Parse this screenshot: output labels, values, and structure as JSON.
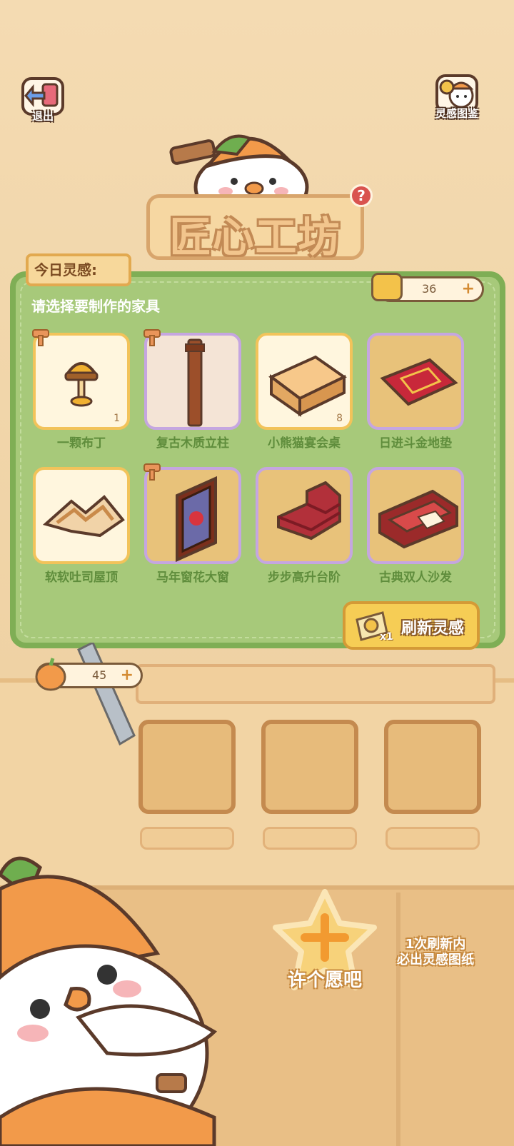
{
  "header": {
    "exit_label": "退出",
    "codex_label": "灵感图鉴",
    "title": "匠心工坊",
    "help_glyph": "?"
  },
  "panel": {
    "today_label": "今日灵感:",
    "prompt": "请选择要制作的家具",
    "inspiration_count": "36",
    "plus_glyph": "+",
    "refresh_label": "刷新灵感",
    "refresh_cost": "x1"
  },
  "items": [
    {
      "name": "一颗布丁",
      "count": "1",
      "icon": "pudding-lamp-icon"
    },
    {
      "name": "复古木质立柱",
      "count": "",
      "icon": "wooden-pillar-icon"
    },
    {
      "name": "小熊猫宴会桌",
      "count": "8",
      "icon": "banquet-table-icon"
    },
    {
      "name": "日进斗金地垫",
      "count": "",
      "icon": "red-rug-icon"
    },
    {
      "name": "软软吐司屋顶",
      "count": "",
      "icon": "toast-roof-icon"
    },
    {
      "name": "马年窗花大窗",
      "count": "",
      "icon": "lattice-window-icon"
    },
    {
      "name": "步步高升台阶",
      "count": "",
      "icon": "red-stairs-icon"
    },
    {
      "name": "古典双人沙发",
      "count": "",
      "icon": "classic-sofa-icon"
    }
  ],
  "pumpkin_count": "45",
  "wish": {
    "label": "许个愿吧",
    "hint_line1": "1次刷新内",
    "hint_line2": "必出灵感图纸"
  },
  "colors": {
    "panel_green": "#a7c97a",
    "item_name_green": "#5f8d3c",
    "button_gold": "#f6cd55",
    "wood": "#e9bf86"
  }
}
